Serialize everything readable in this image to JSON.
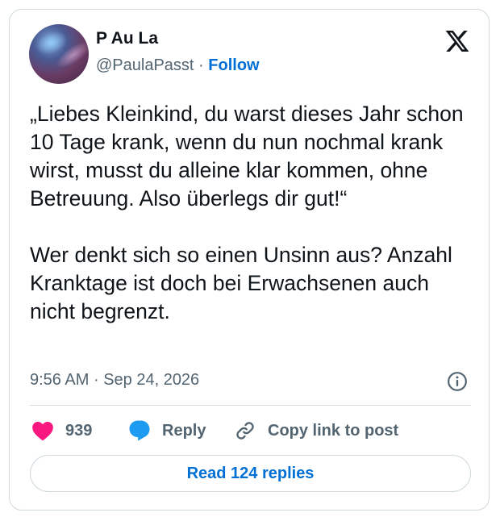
{
  "author": {
    "name": "P Au La",
    "handle": "@PaulaPasst",
    "separator": "·",
    "follow_label": "Follow"
  },
  "tweet": {
    "paragraphs": [
      "„Liebes Kleinkind, du warst dieses Jahr schon 10 Tage krank, wenn du nun nochmal krank wirst, musst du alleine klar kommen, ohne Betreuung. Also überlegs dir gut!“",
      "Wer denkt sich so einen Unsinn aus? Anzahl Kranktage ist doch bei Erwachsenen auch nicht begrenzt."
    ],
    "time": "9:56 AM",
    "separator": "·",
    "date": "Sep 24, 2026"
  },
  "actions": {
    "like_count": "939",
    "reply_label": "Reply",
    "copy_label": "Copy link to post"
  },
  "read_replies_label": "Read 124 replies",
  "icons": {
    "logo": "x-logo-icon",
    "info": "info-icon",
    "like": "heart-icon",
    "reply": "speech-bubble-icon",
    "copy": "link-icon"
  },
  "colors": {
    "text": "#0f1419",
    "secondary": "#536471",
    "link": "#006fd6",
    "heart": "#f91880",
    "reply_bubble": "#1d9bf0",
    "border": "#cfd9de"
  }
}
